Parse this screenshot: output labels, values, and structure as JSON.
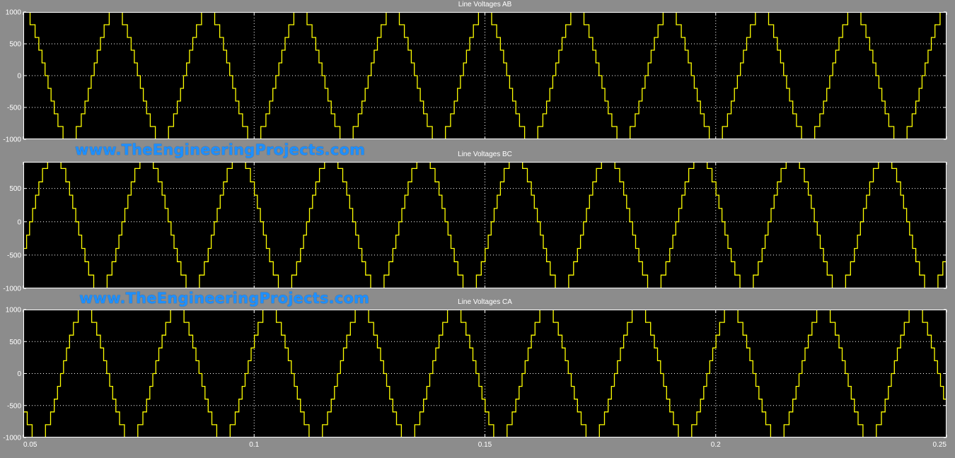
{
  "watermark": "www.TheEngineeringProjects.com",
  "colors": {
    "background": "#8c8c8c",
    "axes": "#000000",
    "frame": "#ffffff",
    "grid": "#ffffff",
    "trace": "#ffff00",
    "watermark": "#1e90ff"
  },
  "chart_data": [
    {
      "type": "line",
      "title": "Line Voltages AB",
      "xlim": [
        0.05,
        0.25
      ],
      "ylim": [
        -1000,
        1000
      ],
      "xticks": [
        0.05,
        0.1,
        0.15,
        0.2,
        0.25
      ],
      "xticklabels": [
        "0.05",
        "0.1",
        "0.15",
        "0.2",
        "0.25"
      ],
      "yticks": [
        -1000,
        -500,
        0,
        500,
        1000
      ],
      "yticklabels": [
        "-1000",
        "-500",
        "0",
        "500",
        "1000"
      ],
      "grid": true,
      "show_xticklabels": false,
      "series": [
        {
          "frequency_hz": 50,
          "amplitude": 1000,
          "phase_deg": 270,
          "staircase_levels": 11,
          "color": "#ffff00"
        }
      ]
    },
    {
      "type": "line",
      "title": "Line Voltages BC",
      "xlim": [
        0.05,
        0.25
      ],
      "ylim": [
        -1000,
        900
      ],
      "xticks": [
        0.05,
        0.1,
        0.15,
        0.2,
        0.25
      ],
      "xticklabels": [
        "0.05",
        "0.1",
        "0.15",
        "0.2",
        "0.25"
      ],
      "yticks": [
        -1000,
        -500,
        0,
        500
      ],
      "yticklabels": [
        "-1000",
        "-500",
        "0",
        "500"
      ],
      "grid": true,
      "show_xticklabels": false,
      "series": [
        {
          "frequency_hz": 50,
          "amplitude": 1000,
          "phase_deg": 150,
          "staircase_levels": 11,
          "color": "#ffff00"
        }
      ]
    },
    {
      "type": "line",
      "title": "Line Voltages CA",
      "xlim": [
        0.05,
        0.25
      ],
      "ylim": [
        -1000,
        1000
      ],
      "xticks": [
        0.05,
        0.1,
        0.15,
        0.2,
        0.25
      ],
      "xticklabels": [
        "0.05",
        "0.1",
        "0.15",
        "0.2",
        "0.25"
      ],
      "yticks": [
        -1000,
        -500,
        0,
        500,
        1000
      ],
      "yticklabels": [
        "-1000",
        "-500",
        "0",
        "500",
        "1000"
      ],
      "grid": true,
      "show_xticklabels": true,
      "series": [
        {
          "frequency_hz": 50,
          "amplitude": 1000,
          "phase_deg": 30,
          "staircase_levels": 11,
          "color": "#ffff00"
        }
      ]
    }
  ]
}
